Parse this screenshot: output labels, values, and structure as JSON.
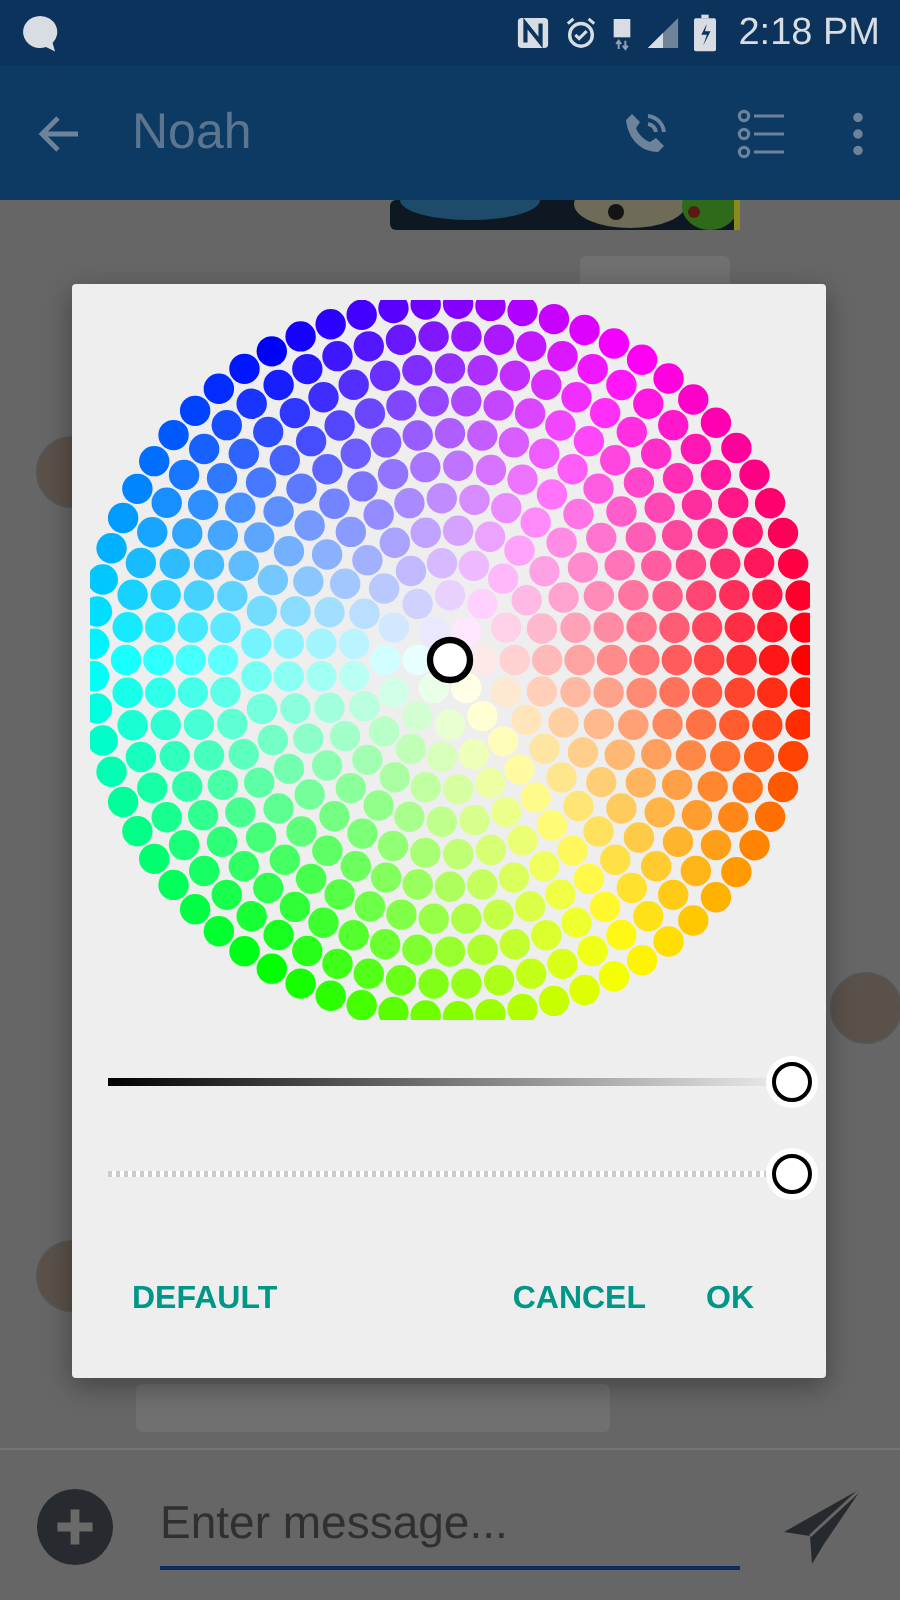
{
  "status_bar": {
    "time": "2:18 PM"
  },
  "app_bar": {
    "title": "Noah"
  },
  "color_picker": {
    "sliders": [
      {
        "kind": "brightness",
        "level": 1
      },
      {
        "kind": "alpha",
        "level": 1
      }
    ],
    "buttons": [
      "DEFAULT",
      "CANCEL",
      "OK"
    ]
  },
  "composer": {
    "placeholder": "Enter message..."
  }
}
